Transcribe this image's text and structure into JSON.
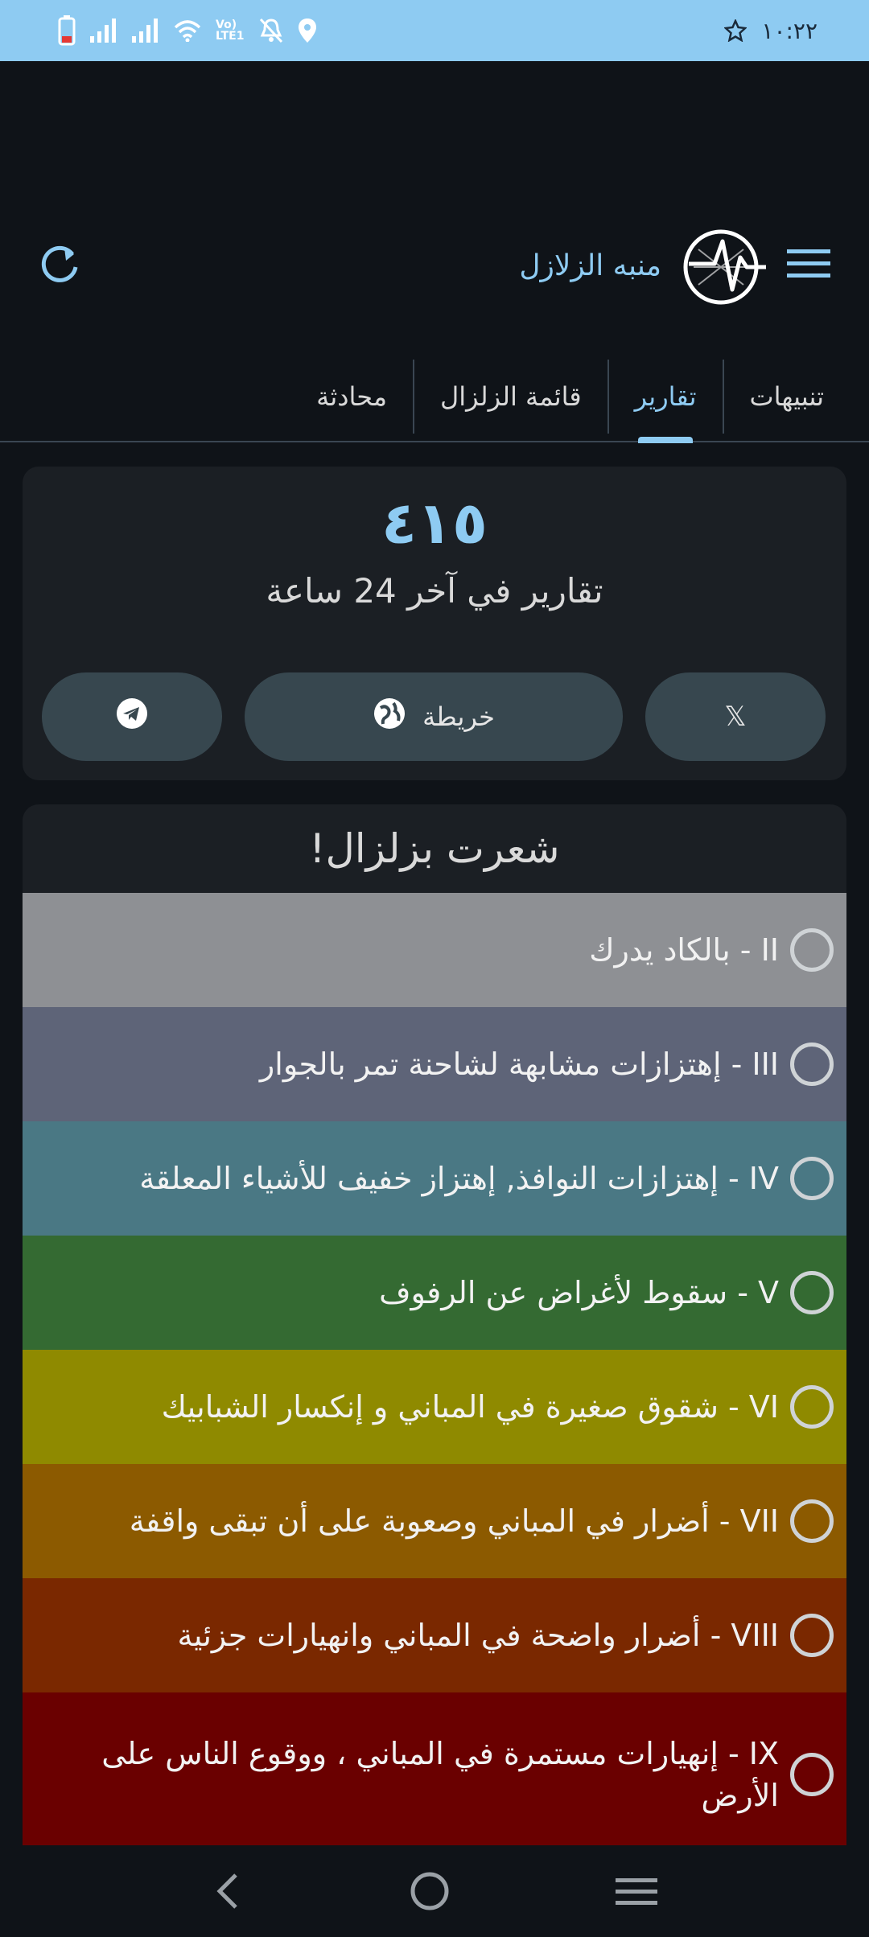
{
  "status_bar": {
    "time": "١٠:٢٢",
    "lte_label": "Vo) LTE1"
  },
  "app_bar": {
    "title": "منبه الزلازل",
    "menu_icon": "hamburger-menu-icon",
    "refresh_icon": "refresh-icon",
    "logo_icon": "earthquake-logo-icon"
  },
  "tabs": [
    {
      "label": "تنبيهات",
      "active": false
    },
    {
      "label": "تقارير",
      "active": true
    },
    {
      "label": "قائمة الزلزال",
      "active": false
    },
    {
      "label": "محادثة",
      "active": false
    }
  ],
  "summary": {
    "count": "٤١٥",
    "caption": "تقارير في آخر 24 ساعة",
    "x_button_label": "𝕏",
    "map_button_label": "خريطة",
    "telegram_icon": "telegram-icon",
    "globe_icon": "globe-icon"
  },
  "felt": {
    "title": "شعرت بزلزال!",
    "levels": [
      {
        "label": "II - بالكاد يدرك",
        "color": "#8e9094"
      },
      {
        "label": "III - إهتزازات مشابهة لشاحنة تمر بالجوار",
        "color": "#5e6478"
      },
      {
        "label": "IV - إهتزازات النوافذ, إهتزاز خفيف للأشياء المعلقة",
        "color": "#4a7884"
      },
      {
        "label": "V - سقوط لأغراض عن الرفوف",
        "color": "#346a32"
      },
      {
        "label": "VI - شقوق صغيرة في المباني و إنكسار الشبابيك",
        "color": "#8f8a00"
      },
      {
        "label": "VII - أضرار في المباني وصعوبة على أن تبقى واقفة",
        "color": "#8c5a00"
      },
      {
        "label": "VIII - أضرار واضحة في المباني وانهيارات جزئية",
        "color": "#7a2800"
      },
      {
        "label": "IX - إنهيارات مستمرة في المباني ، ووقوع الناس على الأرض",
        "color": "#6a0000"
      }
    ]
  },
  "nav": {
    "back_icon": "back-chevron-icon",
    "home_icon": "home-circle-icon",
    "recents_icon": "recents-menu-icon"
  }
}
